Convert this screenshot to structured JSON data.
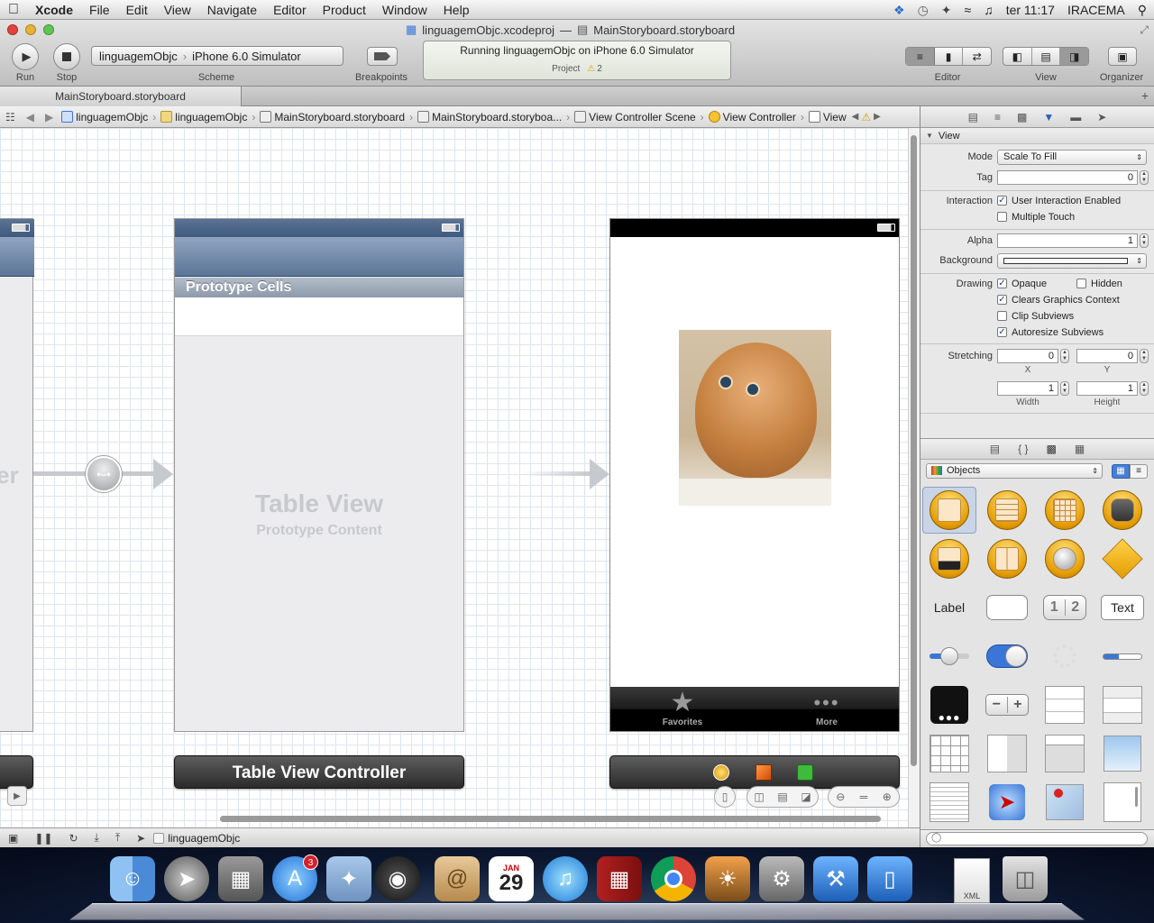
{
  "menubar": {
    "app": "Xcode",
    "items": [
      "File",
      "Edit",
      "View",
      "Navigate",
      "Editor",
      "Product",
      "Window",
      "Help"
    ],
    "clock": "ter 11:17",
    "user": "IRACEMA"
  },
  "window": {
    "title_project": "linguagemObjc.xcodeproj",
    "title_dash": "—",
    "title_file": "MainStoryboard.storyboard"
  },
  "toolbar": {
    "run_label": "Run",
    "stop_label": "Stop",
    "scheme_target": "linguagemObjc",
    "scheme_device": "iPhone 6.0 Simulator",
    "scheme_label": "Scheme",
    "breakpoints_label": "Breakpoints",
    "activity_text": "Running linguagemObjc on iPhone 6.0 Simulator",
    "activity_project": "Project",
    "activity_warnings": "2",
    "editor_label": "Editor",
    "view_label": "View",
    "organizer_label": "Organizer"
  },
  "tab": {
    "label": "MainStoryboard.storyboard"
  },
  "jumpbar": {
    "crumbs": [
      "linguagemObjc",
      "linguagemObjc",
      "MainStoryboard.storyboard",
      "MainStoryboard.storyboa...",
      "View Controller Scene",
      "View Controller",
      "View"
    ]
  },
  "canvas": {
    "left_partial_text": "er",
    "prototype_cells": "Prototype Cells",
    "table_view_title": "Table View",
    "table_view_subtitle": "Prototype Content",
    "table_view_controller": "Table View Controller",
    "tab_favorites": "Favorites",
    "tab_more": "More"
  },
  "debugbar": {
    "target": "linguagemObjc"
  },
  "inspector": {
    "section": "View",
    "mode_label": "Mode",
    "mode_value": "Scale To Fill",
    "tag_label": "Tag",
    "tag_value": "0",
    "interaction_label": "Interaction",
    "user_interaction": "User Interaction Enabled",
    "multiple_touch": "Multiple Touch",
    "alpha_label": "Alpha",
    "alpha_value": "1",
    "background_label": "Background",
    "drawing_label": "Drawing",
    "opaque": "Opaque",
    "hidden": "Hidden",
    "clears_graphics": "Clears Graphics Context",
    "clip_subviews": "Clip Subviews",
    "autoresize_subviews": "Autoresize Subviews",
    "stretching_label": "Stretching",
    "stretch_x": "0",
    "stretch_y": "0",
    "stretch_x_label": "X",
    "stretch_y_label": "Y",
    "stretch_w": "1",
    "stretch_h": "1",
    "width_label": "Width",
    "height_label": "Height"
  },
  "library": {
    "filter_value": "Objects",
    "label_item": "Label",
    "segmented_1": "1",
    "segmented_2": "2",
    "text_item": "Text"
  },
  "dock": {
    "appstore_badge": "3",
    "calendar_month": "JAN",
    "calendar_day": "29",
    "xml_label": "XML"
  },
  "colors": {
    "accent": "#3a76d8",
    "navbar": "#6d86a8",
    "canvas_grid": "#dde6ee"
  }
}
